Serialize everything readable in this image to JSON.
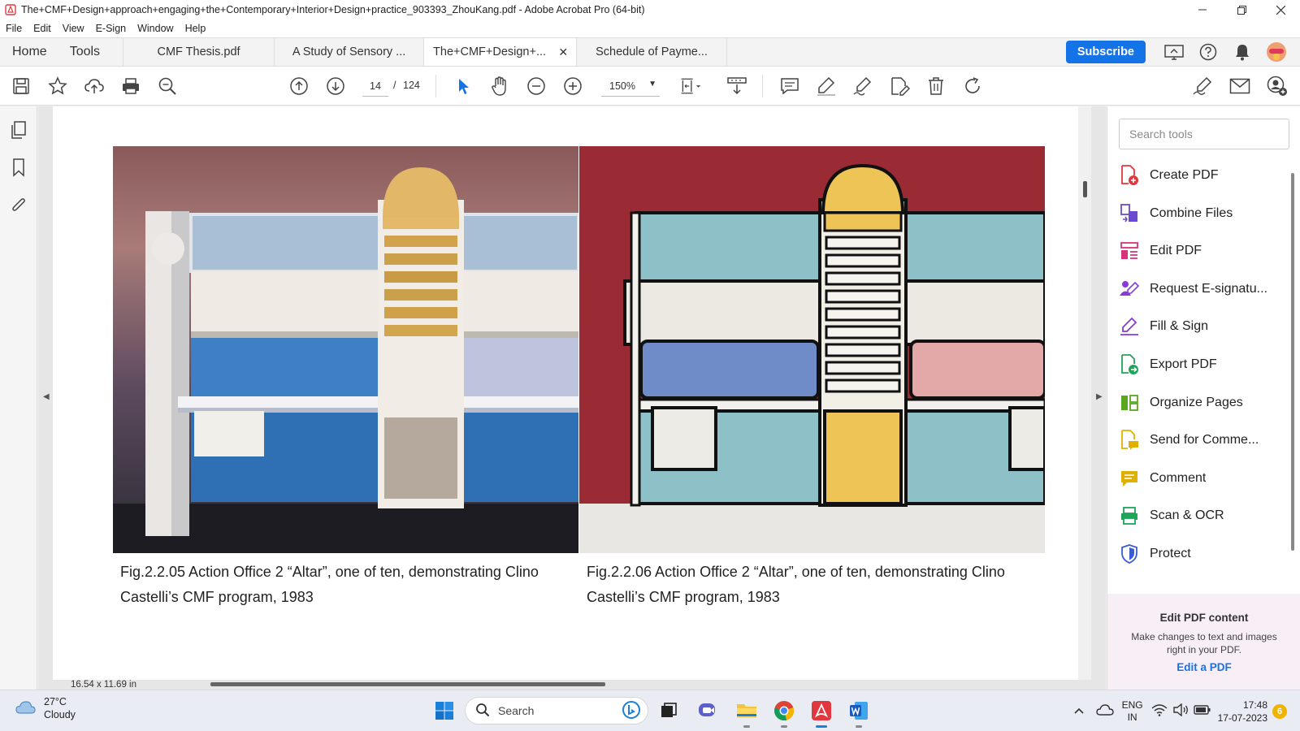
{
  "window": {
    "title": "The+CMF+Design+approach+engaging+the+Contemporary+Interior+Design+practice_903393_ZhouKang.pdf - Adobe Acrobat Pro (64-bit)"
  },
  "menu": [
    "File",
    "Edit",
    "View",
    "E-Sign",
    "Window",
    "Help"
  ],
  "nav_tabs": {
    "home": "Home",
    "tools": "Tools"
  },
  "doc_tabs": [
    "CMF Thesis.pdf",
    "A Study of Sensory ...",
    "The+CMF+Design+...",
    "Schedule of Payme..."
  ],
  "active_tab_index": 2,
  "subscribe_label": "Subscribe",
  "toolbar": {
    "page_current": "14",
    "page_separator": "/",
    "page_total": "124",
    "zoom": "150%"
  },
  "document": {
    "caption_left": "Fig.2.2.05 Action Office 2 “Altar”, one of ten, demonstrating Clino Castelli’s CMF program, 1983",
    "caption_right": "Fig.2.2.06 Action Office 2 “Altar”, one of ten, demonstrating Clino Castelli’s CMF program, 1983",
    "page_size": "16.54 x 11.69 in"
  },
  "right_panel": {
    "search_placeholder": "Search tools",
    "tools": [
      {
        "label": "Create PDF",
        "icon": "create-pdf-icon",
        "color": "#e0383e"
      },
      {
        "label": "Combine Files",
        "icon": "combine-files-icon",
        "color": "#6a4bd0"
      },
      {
        "label": "Edit PDF",
        "icon": "edit-pdf-icon",
        "color": "#d6337a"
      },
      {
        "label": "Request E-signatu...",
        "icon": "request-esign-icon",
        "color": "#8a3ad6"
      },
      {
        "label": "Fill & Sign",
        "icon": "fill-sign-icon",
        "color": "#8a3ad6"
      },
      {
        "label": "Export PDF",
        "icon": "export-pdf-icon",
        "color": "#1fa45a"
      },
      {
        "label": "Organize Pages",
        "icon": "organize-pages-icon",
        "color": "#59a61f"
      },
      {
        "label": "Send for Comme...",
        "icon": "send-comment-icon",
        "color": "#e0b000"
      },
      {
        "label": "Comment",
        "icon": "comment-icon",
        "color": "#e0b000"
      },
      {
        "label": "Scan & OCR",
        "icon": "scan-ocr-icon",
        "color": "#1fa45a"
      },
      {
        "label": "Protect",
        "icon": "protect-icon",
        "color": "#3a5bd6"
      }
    ],
    "promo": {
      "title": "Edit PDF content",
      "desc": "Make changes to text and images right in your PDF.",
      "link": "Edit a PDF"
    }
  },
  "taskbar": {
    "weather_temp": "27°C",
    "weather_desc": "Cloudy",
    "search_label": "Search",
    "lang_line1": "ENG",
    "lang_line2": "IN",
    "time": "17:48",
    "date": "17-07-2023",
    "notification_count": "6"
  },
  "colors": {
    "accent": "#1473e6",
    "acrobat_red": "#e0383e"
  }
}
